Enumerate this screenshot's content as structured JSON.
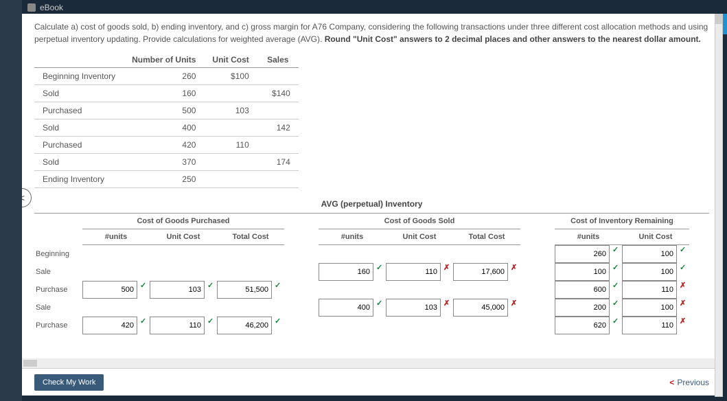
{
  "tab": {
    "label": "eBook"
  },
  "problem": {
    "line1": "Calculate a) cost of goods sold, b) ending inventory, and c) gross margin for A76 Company, considering the following transactions under three different cost allocation methods and using perpetual inventory updating. Provide calculations for weighted average (AVG). ",
    "bold": "Round \"Unit Cost\" answers to 2 decimal places and other answers to the nearest dollar amount."
  },
  "transHead": {
    "units": "Number of Units",
    "unitCost": "Unit Cost",
    "sales": "Sales"
  },
  "trans": [
    {
      "label": "Beginning Inventory",
      "units": "260",
      "unitCost": "$100",
      "sales": ""
    },
    {
      "label": "Sold",
      "units": "160",
      "unitCost": "",
      "sales": "$140"
    },
    {
      "label": "Purchased",
      "units": "500",
      "unitCost": "103",
      "sales": ""
    },
    {
      "label": "Sold",
      "units": "400",
      "unitCost": "",
      "sales": "142"
    },
    {
      "label": "Purchased",
      "units": "420",
      "unitCost": "110",
      "sales": ""
    },
    {
      "label": "Sold",
      "units": "370",
      "unitCost": "",
      "sales": "174"
    },
    {
      "label": "Ending Inventory",
      "units": "250",
      "unitCost": "",
      "sales": ""
    }
  ],
  "avgTitle": "AVG (perpetual) Inventory",
  "groups": {
    "g1": "Cost of Goods Purchased",
    "g2": "Cost of Goods Sold",
    "g3": "Cost of Inventory Remaining"
  },
  "cols": {
    "units": "#units",
    "unitCost": "Unit Cost",
    "total": "Total Cost"
  },
  "rows": {
    "r0": {
      "label": "Beginning",
      "i_units": "260",
      "i_uc": "100"
    },
    "r1": {
      "label": "Sale",
      "s_units": "160",
      "s_uc": "110",
      "s_tc": "17,600",
      "i_units": "100",
      "i_uc": "100"
    },
    "r2": {
      "label": "Purchase",
      "p_units": "500",
      "p_uc": "103",
      "p_tc": "51,500",
      "i_units": "600",
      "i_uc": "110"
    },
    "r3": {
      "label": "Sale",
      "s_units": "400",
      "s_uc": "103",
      "s_tc": "45,000",
      "i_units": "200",
      "i_uc": "100"
    },
    "r4": {
      "label": "Purchase",
      "p_units": "420",
      "p_uc": "110",
      "p_tc": "46,200",
      "i_units": "620",
      "i_uc": "110"
    }
  },
  "marks": {
    "ok": "✓",
    "bad": "✗"
  },
  "footer": {
    "check": "Check My Work",
    "prev": "Previous"
  },
  "dollar": "$"
}
